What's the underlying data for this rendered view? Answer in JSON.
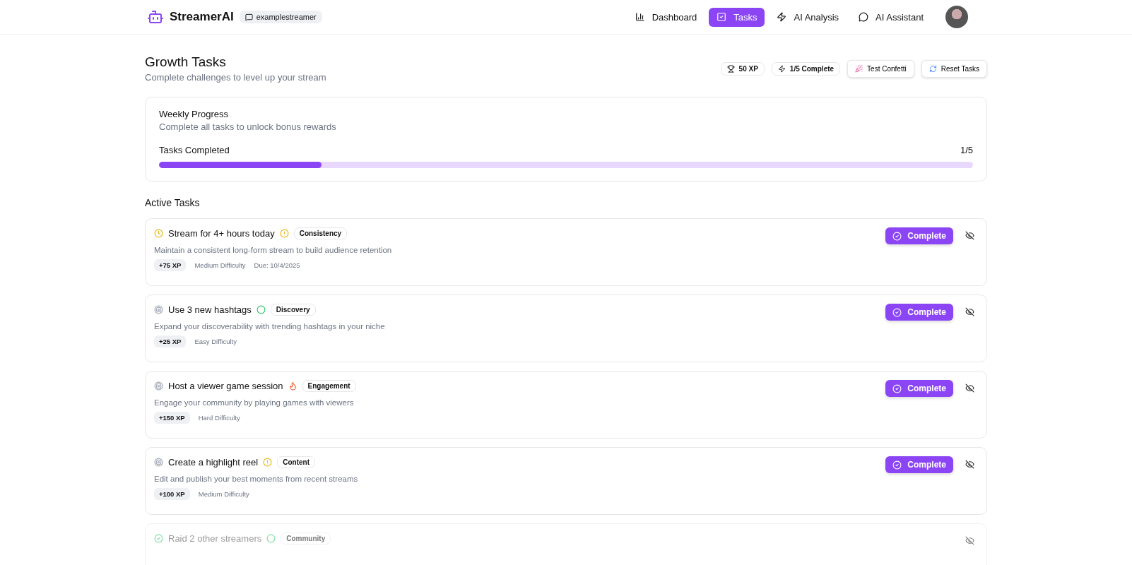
{
  "brand": {
    "name": "StreamerAI",
    "channel": "examplestreamer"
  },
  "nav": [
    {
      "label": "Dashboard",
      "selected": false
    },
    {
      "label": "Tasks",
      "selected": true
    },
    {
      "label": "AI Analysis",
      "selected": false
    },
    {
      "label": "AI Assistant",
      "selected": false
    }
  ],
  "page": {
    "title": "Growth Tasks",
    "subtitle": "Complete challenges to level up your stream"
  },
  "stats": [
    {
      "label": "50 XP"
    },
    {
      "label": "1/5 Complete"
    }
  ],
  "actions": [
    {
      "label": "Test Confetti"
    },
    {
      "label": "Reset Tasks"
    }
  ],
  "progress": {
    "title": "Weekly Progress",
    "subtitle": "Complete all tasks to unlock bonus rewards",
    "label": "Tasks Completed",
    "count": "1/5",
    "level": 0.2
  },
  "section_title": "Active Tasks",
  "tasks": [
    {
      "kind": "pending",
      "title": "Stream for 4+ hours today",
      "priority": {
        "kind": "medium"
      },
      "category": "Consistency",
      "description": "Maintain a consistent long-form stream to build audience retention",
      "xp": "+75 XP",
      "difficulty": "Medium Difficulty",
      "due": "Due: 10/4/2025",
      "completed": false,
      "button": "Complete"
    },
    {
      "kind": "todo",
      "title": "Use 3 new hashtags",
      "priority": {
        "kind": "low"
      },
      "category": "Discovery",
      "description": "Expand your discoverability with trending hashtags in your niche",
      "xp": "+25 XP",
      "difficulty": "Easy Difficulty",
      "completed": false,
      "button": "Complete"
    },
    {
      "kind": "todo",
      "title": "Host a viewer game session",
      "priority": {
        "kind": "high"
      },
      "category": "Engagement",
      "description": "Engage your community by playing games with viewers",
      "xp": "+150 XP",
      "difficulty": "Hard Difficulty",
      "completed": false,
      "button": "Complete"
    },
    {
      "kind": "todo",
      "title": "Create a highlight reel",
      "priority": {
        "kind": "medium"
      },
      "category": "Content",
      "description": "Edit and publish your best moments from recent streams",
      "xp": "+100 XP",
      "difficulty": "Medium Difficulty",
      "completed": false,
      "button": "Complete"
    },
    {
      "kind": "done",
      "title": "Raid 2 other streamers",
      "priority": {
        "kind": "low"
      },
      "category": "Community",
      "completed": true
    }
  ]
}
